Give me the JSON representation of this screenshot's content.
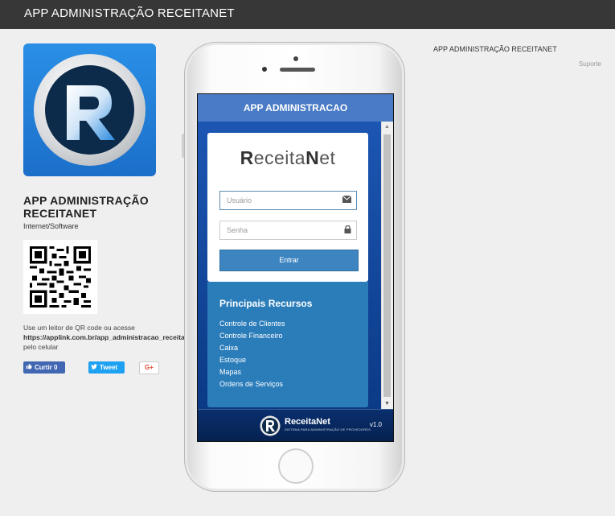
{
  "topbar": {
    "title": "APP ADMINISTRAÇÃO RECEITANET"
  },
  "left": {
    "app_name": "APP ADMINISTRAÇÃO RECEITANET",
    "category": "Internet/Software",
    "qr_instructions": "Use um leitor de QR code ou acesse",
    "qr_url": "https://applink.com.br/app_administracao_receitanet",
    "qr_suffix": "pelo celular",
    "social": {
      "facebook": "Curtir 0",
      "twitter": "Tweet",
      "gplus": "G+"
    }
  },
  "right": {
    "title": "APP ADMINISTRAÇÃO RECEITANET",
    "support": "Suporte"
  },
  "app": {
    "header": "APP ADMINISTRACAO",
    "brand": {
      "r": "R",
      "part1": "eceita",
      "n": "N",
      "part2": "et"
    },
    "username_placeholder": "Usuário",
    "password_placeholder": "Senha",
    "login_button": "Entrar",
    "features_title": "Principais Recursos",
    "features": [
      "Controle de Clientes",
      "Controle Financeiro",
      "Caixa",
      "Estoque",
      "Mapas",
      "Ordens de Serviços"
    ],
    "footer_brand": "ReceitaNet",
    "footer_tagline": "SISTEMA PARA ADMINISTRAÇÃO DE PROVEDORES",
    "version": "v1.0"
  },
  "colors": {
    "topbar": "#373737",
    "app_header": "#4a7bc6",
    "features_bg": "#2b7dba",
    "button": "#3d85c1"
  },
  "icons": {
    "email": "envelope-icon",
    "password": "lock-icon",
    "like": "thumbs-up-icon",
    "tweet": "twitter-bird-icon"
  }
}
